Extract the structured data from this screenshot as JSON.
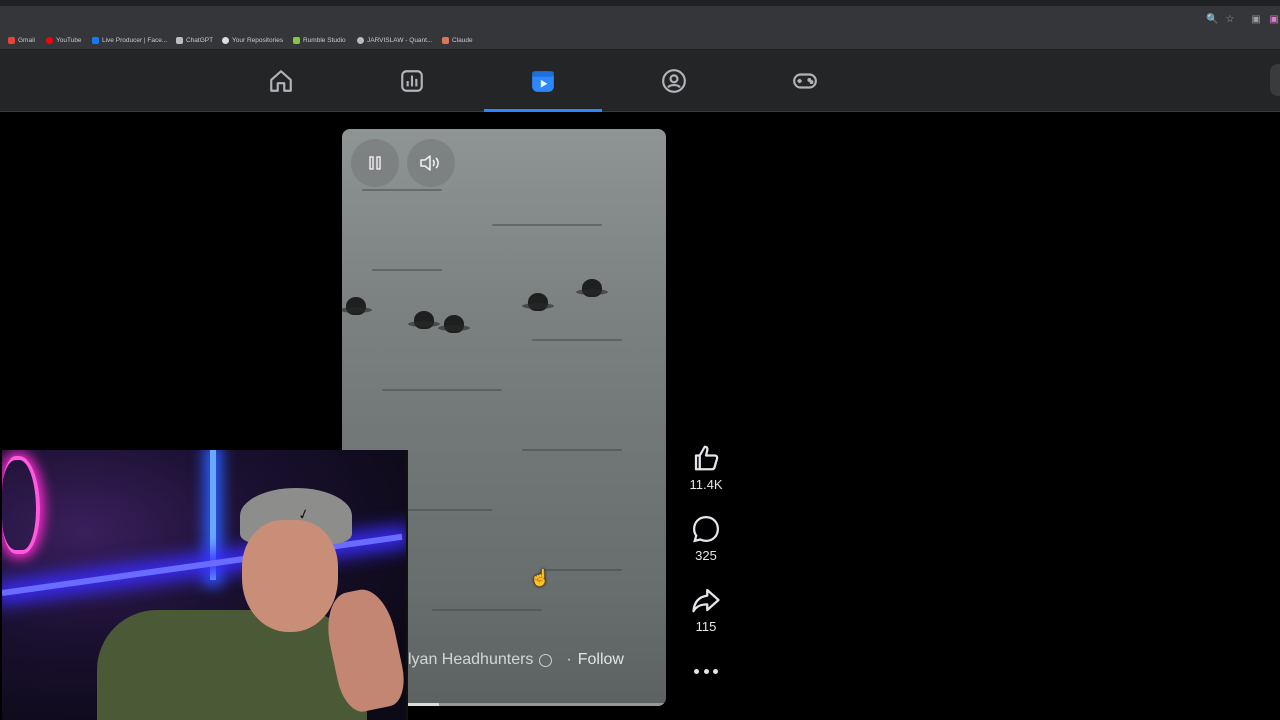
{
  "browser": {
    "bookmarks": [
      {
        "label": "Gmail",
        "icon": "gmail-icon",
        "color": "#ea4335"
      },
      {
        "label": "YouTube",
        "icon": "youtube-icon",
        "color": "#ff0000"
      },
      {
        "label": "Live Producer | Face...",
        "icon": "facebook-icon",
        "color": "#1877f2"
      },
      {
        "label": "ChatGPT",
        "icon": "chatgpt-icon",
        "color": "#bdbdbd"
      },
      {
        "label": "Your Repositories",
        "icon": "github-icon",
        "color": "#dddddd"
      },
      {
        "label": "Rumble Studio",
        "icon": "rumble-icon",
        "color": "#85c742"
      },
      {
        "label": "JARVISLAW - Quant...",
        "icon": "link-icon",
        "color": "#bbbbbb"
      },
      {
        "label": "Claude",
        "icon": "claude-icon",
        "color": "#d9775a"
      }
    ]
  },
  "nav": {
    "tabs": [
      {
        "name": "home",
        "icon": "home-icon",
        "active": false
      },
      {
        "name": "dashboard",
        "icon": "bar-chart-icon",
        "active": false
      },
      {
        "name": "reels",
        "icon": "reels-icon",
        "active": true
      },
      {
        "name": "groups",
        "icon": "groups-icon",
        "active": false
      },
      {
        "name": "gaming",
        "icon": "gamepad-icon",
        "active": false
      }
    ],
    "accent": "#2d88ff"
  },
  "video": {
    "author": "lyan Headhunters",
    "follow_label": "Follow",
    "separator": "·",
    "progress": 0.3
  },
  "actions": {
    "likes": "11.4K",
    "comments": "325",
    "shares": "115"
  }
}
